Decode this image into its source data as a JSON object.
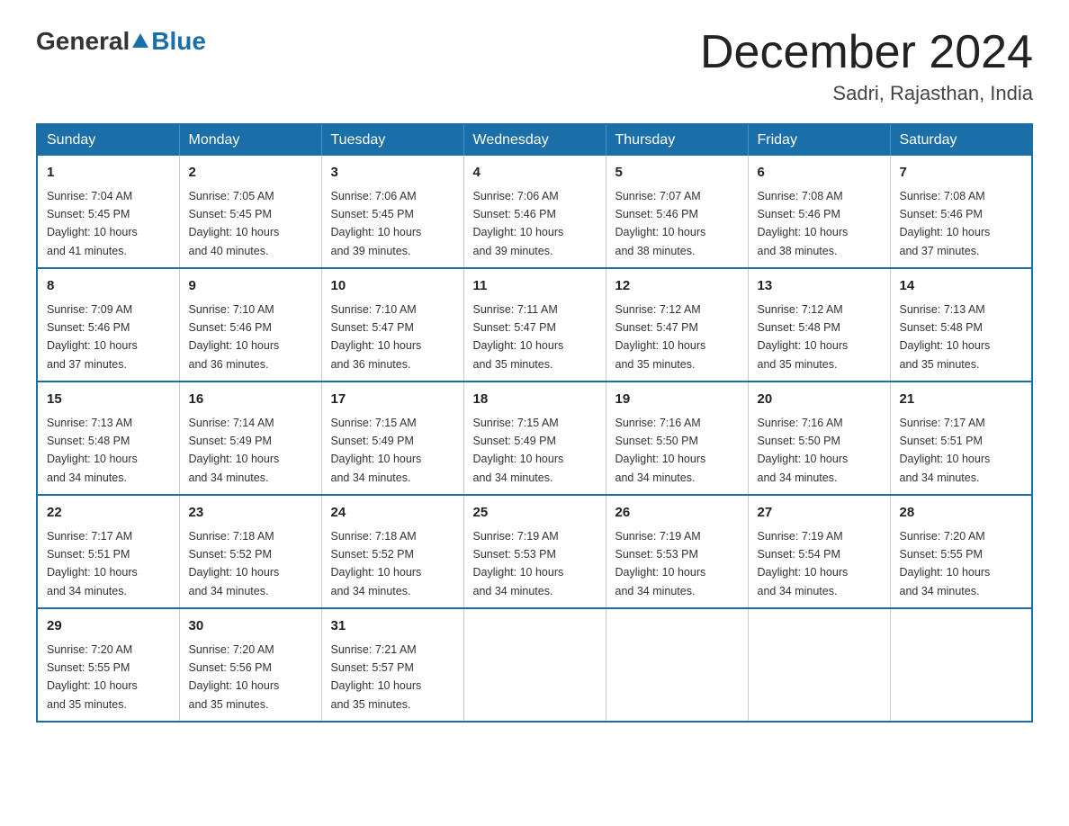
{
  "header": {
    "logo_general": "General",
    "logo_blue": "Blue",
    "month_title": "December 2024",
    "subtitle": "Sadri, Rajasthan, India"
  },
  "days_of_week": [
    "Sunday",
    "Monday",
    "Tuesday",
    "Wednesday",
    "Thursday",
    "Friday",
    "Saturday"
  ],
  "weeks": [
    [
      {
        "day": "1",
        "sunrise": "7:04 AM",
        "sunset": "5:45 PM",
        "daylight": "10 hours and 41 minutes."
      },
      {
        "day": "2",
        "sunrise": "7:05 AM",
        "sunset": "5:45 PM",
        "daylight": "10 hours and 40 minutes."
      },
      {
        "day": "3",
        "sunrise": "7:06 AM",
        "sunset": "5:45 PM",
        "daylight": "10 hours and 39 minutes."
      },
      {
        "day": "4",
        "sunrise": "7:06 AM",
        "sunset": "5:46 PM",
        "daylight": "10 hours and 39 minutes."
      },
      {
        "day": "5",
        "sunrise": "7:07 AM",
        "sunset": "5:46 PM",
        "daylight": "10 hours and 38 minutes."
      },
      {
        "day": "6",
        "sunrise": "7:08 AM",
        "sunset": "5:46 PM",
        "daylight": "10 hours and 38 minutes."
      },
      {
        "day": "7",
        "sunrise": "7:08 AM",
        "sunset": "5:46 PM",
        "daylight": "10 hours and 37 minutes."
      }
    ],
    [
      {
        "day": "8",
        "sunrise": "7:09 AM",
        "sunset": "5:46 PM",
        "daylight": "10 hours and 37 minutes."
      },
      {
        "day": "9",
        "sunrise": "7:10 AM",
        "sunset": "5:46 PM",
        "daylight": "10 hours and 36 minutes."
      },
      {
        "day": "10",
        "sunrise": "7:10 AM",
        "sunset": "5:47 PM",
        "daylight": "10 hours and 36 minutes."
      },
      {
        "day": "11",
        "sunrise": "7:11 AM",
        "sunset": "5:47 PM",
        "daylight": "10 hours and 35 minutes."
      },
      {
        "day": "12",
        "sunrise": "7:12 AM",
        "sunset": "5:47 PM",
        "daylight": "10 hours and 35 minutes."
      },
      {
        "day": "13",
        "sunrise": "7:12 AM",
        "sunset": "5:48 PM",
        "daylight": "10 hours and 35 minutes."
      },
      {
        "day": "14",
        "sunrise": "7:13 AM",
        "sunset": "5:48 PM",
        "daylight": "10 hours and 35 minutes."
      }
    ],
    [
      {
        "day": "15",
        "sunrise": "7:13 AM",
        "sunset": "5:48 PM",
        "daylight": "10 hours and 34 minutes."
      },
      {
        "day": "16",
        "sunrise": "7:14 AM",
        "sunset": "5:49 PM",
        "daylight": "10 hours and 34 minutes."
      },
      {
        "day": "17",
        "sunrise": "7:15 AM",
        "sunset": "5:49 PM",
        "daylight": "10 hours and 34 minutes."
      },
      {
        "day": "18",
        "sunrise": "7:15 AM",
        "sunset": "5:49 PM",
        "daylight": "10 hours and 34 minutes."
      },
      {
        "day": "19",
        "sunrise": "7:16 AM",
        "sunset": "5:50 PM",
        "daylight": "10 hours and 34 minutes."
      },
      {
        "day": "20",
        "sunrise": "7:16 AM",
        "sunset": "5:50 PM",
        "daylight": "10 hours and 34 minutes."
      },
      {
        "day": "21",
        "sunrise": "7:17 AM",
        "sunset": "5:51 PM",
        "daylight": "10 hours and 34 minutes."
      }
    ],
    [
      {
        "day": "22",
        "sunrise": "7:17 AM",
        "sunset": "5:51 PM",
        "daylight": "10 hours and 34 minutes."
      },
      {
        "day": "23",
        "sunrise": "7:18 AM",
        "sunset": "5:52 PM",
        "daylight": "10 hours and 34 minutes."
      },
      {
        "day": "24",
        "sunrise": "7:18 AM",
        "sunset": "5:52 PM",
        "daylight": "10 hours and 34 minutes."
      },
      {
        "day": "25",
        "sunrise": "7:19 AM",
        "sunset": "5:53 PM",
        "daylight": "10 hours and 34 minutes."
      },
      {
        "day": "26",
        "sunrise": "7:19 AM",
        "sunset": "5:53 PM",
        "daylight": "10 hours and 34 minutes."
      },
      {
        "day": "27",
        "sunrise": "7:19 AM",
        "sunset": "5:54 PM",
        "daylight": "10 hours and 34 minutes."
      },
      {
        "day": "28",
        "sunrise": "7:20 AM",
        "sunset": "5:55 PM",
        "daylight": "10 hours and 34 minutes."
      }
    ],
    [
      {
        "day": "29",
        "sunrise": "7:20 AM",
        "sunset": "5:55 PM",
        "daylight": "10 hours and 35 minutes."
      },
      {
        "day": "30",
        "sunrise": "7:20 AM",
        "sunset": "5:56 PM",
        "daylight": "10 hours and 35 minutes."
      },
      {
        "day": "31",
        "sunrise": "7:21 AM",
        "sunset": "5:57 PM",
        "daylight": "10 hours and 35 minutes."
      },
      null,
      null,
      null,
      null
    ]
  ],
  "labels": {
    "sunrise": "Sunrise:",
    "sunset": "Sunset:",
    "daylight": "Daylight:"
  }
}
